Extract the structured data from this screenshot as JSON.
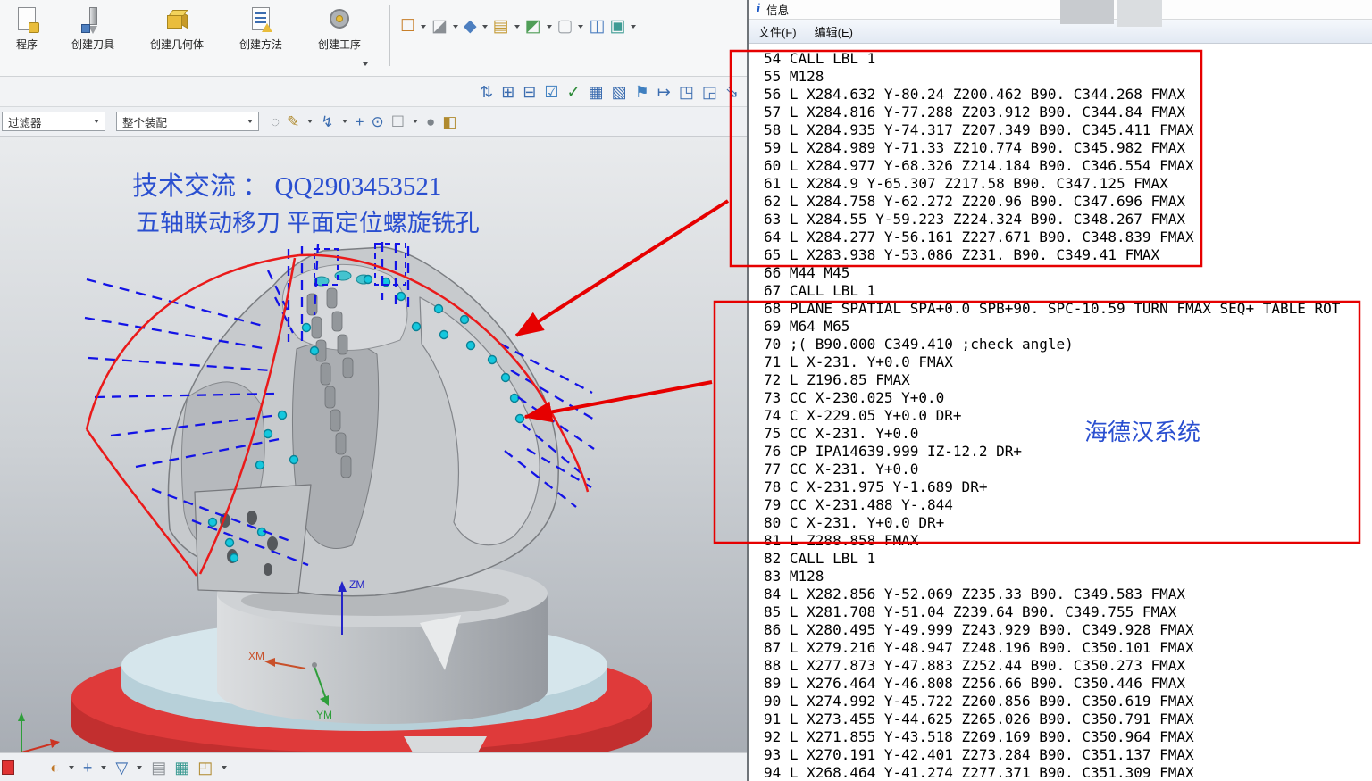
{
  "ribbon": {
    "tabs": [
      {
        "label": "程序"
      },
      {
        "label": "创建刀具"
      },
      {
        "label": "创建几何体"
      },
      {
        "label": "创建方法"
      },
      {
        "label": "创建工序"
      }
    ]
  },
  "selection_bar": {
    "filter": "过滤器",
    "scope": "整个装配"
  },
  "viewport": {
    "note_line1": "技术交流 ： QQ2903453521",
    "note_line2": "五轴联动移刀 平面定位螺旋铣孔",
    "axes": {
      "z": "ZM",
      "x": "XM",
      "y": "YM"
    }
  },
  "info_window": {
    "title": "信息",
    "icon": "i",
    "menu": {
      "file": "文件(F)",
      "edit": "编辑(E)"
    },
    "system_note": "海德汉系统",
    "code_lines": [
      "54 CALL LBL 1",
      "55 M128",
      "56 L X284.632 Y-80.24 Z200.462 B90. C344.268 FMAX",
      "57 L X284.816 Y-77.288 Z203.912 B90. C344.84 FMAX",
      "58 L X284.935 Y-74.317 Z207.349 B90. C345.411 FMAX",
      "59 L X284.989 Y-71.33 Z210.774 B90. C345.982 FMAX",
      "60 L X284.977 Y-68.326 Z214.184 B90. C346.554 FMAX",
      "61 L X284.9 Y-65.307 Z217.58 B90. C347.125 FMAX",
      "62 L X284.758 Y-62.272 Z220.96 B90. C347.696 FMAX",
      "63 L X284.55 Y-59.223 Z224.324 B90. C348.267 FMAX",
      "64 L X284.277 Y-56.161 Z227.671 B90. C348.839 FMAX",
      "65 L X283.938 Y-53.086 Z231. B90. C349.41 FMAX",
      "66 M44 M45",
      "67 CALL LBL 1",
      "68 PLANE SPATIAL SPA+0.0 SPB+90. SPC-10.59 TURN FMAX SEQ+ TABLE ROT",
      "69 M64 M65",
      "70 ;( B90.000 C349.410 ;check angle)",
      "71 L X-231. Y+0.0 FMAX",
      "72 L Z196.85 FMAX",
      "73 CC X-230.025 Y+0.0",
      "74 C X-229.05 Y+0.0 DR+",
      "75 CC X-231. Y+0.0",
      "76 CP IPA14639.999 IZ-12.2 DR+",
      "77 CC X-231. Y+0.0",
      "78 C X-231.975 Y-1.689 DR+",
      "79 CC X-231.488 Y-.844",
      "80 C X-231. Y+0.0 DR+",
      "81 L Z288.858 FMAX",
      "82 CALL LBL 1",
      "83 M128",
      "84 L X282.856 Y-52.069 Z235.33 B90. C349.583 FMAX",
      "85 L X281.708 Y-51.04 Z239.64 B90. C349.755 FMAX",
      "86 L X280.495 Y-49.999 Z243.929 B90. C349.928 FMAX",
      "87 L X279.216 Y-48.947 Z248.196 B90. C350.101 FMAX",
      "88 L X277.873 Y-47.883 Z252.44 B90. C350.273 FMAX",
      "89 L X276.464 Y-46.808 Z256.66 B90. C350.446 FMAX",
      "90 L X274.992 Y-45.722 Z260.856 B90. C350.619 FMAX",
      "91 L X273.455 Y-44.625 Z265.026 B90. C350.791 FMAX",
      "92 L X271.855 Y-43.518 Z269.169 B90. C350.964 FMAX",
      "93 L X270.191 Y-42.401 Z273.284 B90. C351.137 FMAX",
      "94 L X268.464 Y-41.274 Z277.371 B90. C351.309 FMAX"
    ]
  },
  "toolbars": {
    "view_group": [
      {
        "name": "fit-selection-box-icon",
        "glyph": "☐",
        "color": "#c77f2a",
        "caret": true
      },
      {
        "name": "section-view-icon",
        "glyph": "◪",
        "color": "#8a8f94",
        "caret": true
      },
      {
        "name": "shaded-cube-icon",
        "glyph": "◆",
        "color": "#4d7fc0",
        "caret": true
      },
      {
        "name": "open-folder-icon",
        "glyph": "▤",
        "color": "#c49a35",
        "caret": true
      },
      {
        "name": "assembly-boxes-icon",
        "glyph": "◩",
        "color": "#4f9e57",
        "caret": true
      },
      {
        "name": "empty-frame-icon",
        "glyph": "▢",
        "color": "#9aa0a6",
        "caret": true
      },
      {
        "name": "window-split-icon",
        "glyph": "◫",
        "color": "#4d7fc0",
        "caret": false
      },
      {
        "name": "new-view-window-icon",
        "glyph": "▣",
        "color": "#3f9c94",
        "caret": true
      }
    ],
    "row2": [
      {
        "name": "snap-up-down-icon",
        "glyph": "⇅"
      },
      {
        "name": "grid-plus-icon",
        "glyph": "⊞"
      },
      {
        "name": "grid-minus-icon",
        "glyph": "⊟"
      },
      {
        "name": "checkbox-icon",
        "glyph": "☑",
        "color": "#3f7fc0"
      },
      {
        "name": "check-icon",
        "glyph": "✓",
        "color": "#2e8b3a"
      },
      {
        "name": "pattern-grid-icon",
        "glyph": "▦"
      },
      {
        "name": "hatch-icon",
        "glyph": "▧"
      },
      {
        "name": "flag-icon",
        "glyph": "⚑",
        "color": "#3f7fc0"
      },
      {
        "name": "map-to-icon",
        "glyph": "↦"
      },
      {
        "name": "corner-ne-icon",
        "glyph": "◳"
      },
      {
        "name": "corner-se-icon",
        "glyph": "◲"
      },
      {
        "name": "arrow-se-icon",
        "glyph": "⇘"
      }
    ],
    "row3": [
      {
        "name": "refresh-circle-icon",
        "glyph": "◌",
        "color": "#8a8f94"
      },
      {
        "name": "pencil-icon",
        "glyph": "✎",
        "color": "#b08a2e",
        "caret": true
      },
      {
        "name": "lightning-icon",
        "glyph": "↯",
        "color": "#3c6db0",
        "caret": true
      },
      {
        "name": "plus-icon",
        "glyph": "+",
        "color": "#3c6db0"
      },
      {
        "name": "target-circle-icon",
        "glyph": "⊙",
        "color": "#3c6db0"
      },
      {
        "name": "dashed-frame-icon",
        "glyph": "☐",
        "color": "#8a8f94",
        "caret": true
      },
      {
        "name": "sphere-icon",
        "glyph": "●",
        "color": "#7d848a"
      },
      {
        "name": "half-cube-icon",
        "glyph": "◧",
        "color": "#b08a2e"
      }
    ],
    "bottom": [
      {
        "name": "render-sphere-icon",
        "glyph": "◐",
        "color": "#c07828",
        "caret": true
      },
      {
        "name": "move-cross-icon",
        "glyph": "+",
        "color": "#3c6db0",
        "caret": true
      },
      {
        "name": "funnel-icon",
        "glyph": "▽",
        "color": "#3c6db0",
        "caret": true
      },
      {
        "name": "clipboard-icon",
        "glyph": "▤",
        "color": "#8a8f94"
      },
      {
        "name": "layers-icon",
        "glyph": "▦",
        "color": "#3f9c94"
      },
      {
        "name": "box-corner-icon",
        "glyph": "◰",
        "color": "#b08a2e",
        "caret": true
      }
    ]
  },
  "colors": {
    "highlight_red": "#e60000",
    "note_blue": "#2a4fd0",
    "dash_blue": "#1313e6"
  }
}
